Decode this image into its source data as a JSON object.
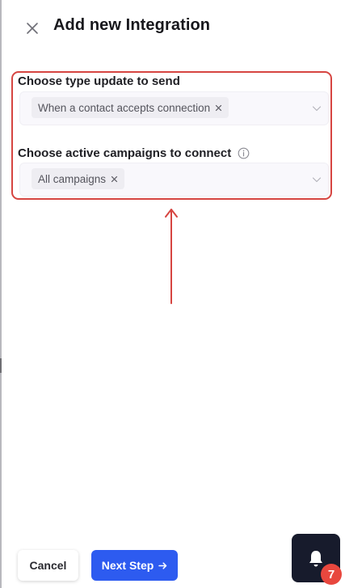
{
  "dialog": {
    "title": "Add new Integration"
  },
  "fields": [
    {
      "label": "Choose type update to send",
      "selected": [
        "When a contact accepts connection"
      ]
    },
    {
      "label": "Choose active campaigns to connect",
      "selected": [
        "All campaigns"
      ]
    }
  ],
  "footer": {
    "cancel_label": "Cancel",
    "next_label": "Next Step"
  },
  "notifications": {
    "count": "7"
  },
  "colors": {
    "accent": "#2d5bf0",
    "highlight": "#d64541",
    "badge": "#e8473e",
    "notification_bg": "#171b2c"
  },
  "icons": {
    "close": "close-icon",
    "info": "info-icon",
    "chevron": "chevron-down-icon",
    "remove": "remove-chip-icon",
    "arrow_right": "arrow-right-icon",
    "bell": "bell-icon"
  }
}
